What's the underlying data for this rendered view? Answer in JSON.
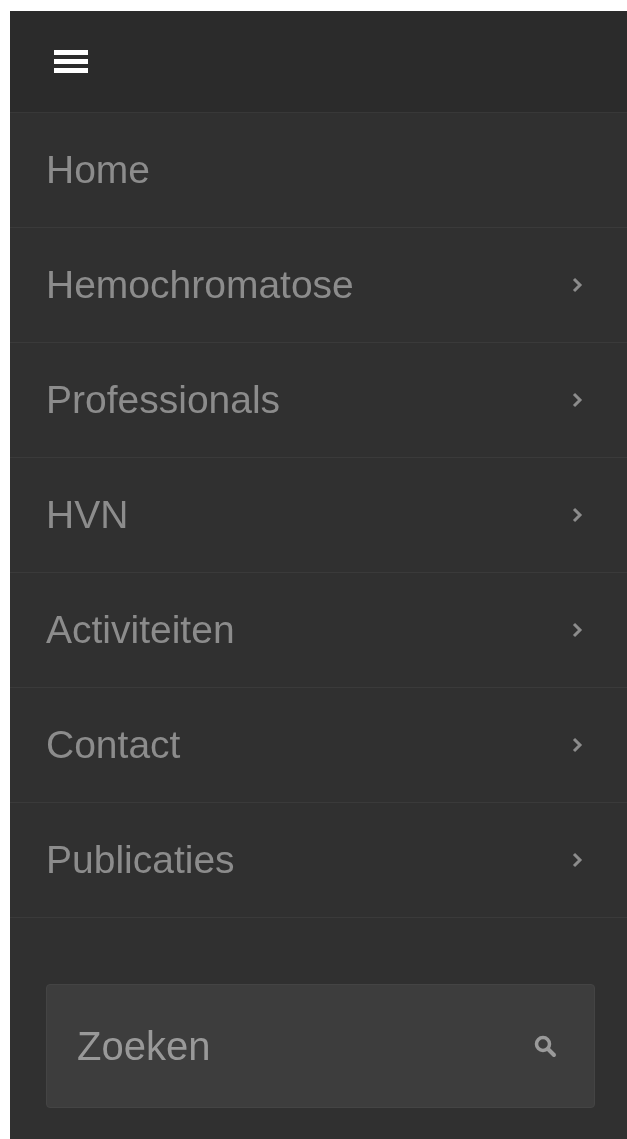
{
  "menu": {
    "items": [
      {
        "label": "Home",
        "has_submenu": false
      },
      {
        "label": "Hemochromatose",
        "has_submenu": true
      },
      {
        "label": "Professionals",
        "has_submenu": true
      },
      {
        "label": "HVN",
        "has_submenu": true
      },
      {
        "label": "Activiteiten",
        "has_submenu": true
      },
      {
        "label": "Contact",
        "has_submenu": true
      },
      {
        "label": "Publicaties",
        "has_submenu": true
      }
    ]
  },
  "search": {
    "placeholder": "Zoeken"
  }
}
